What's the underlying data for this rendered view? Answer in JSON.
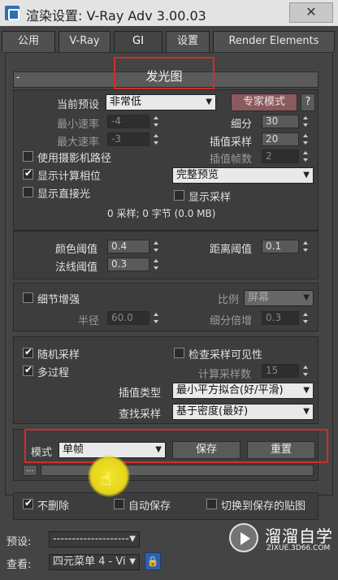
{
  "window": {
    "title": "渲染设置: V-Ray Adv 3.00.03",
    "close_glyph": "✕"
  },
  "tabs": [
    {
      "label": "公用"
    },
    {
      "label": "V-Ray"
    },
    {
      "label": "GI"
    },
    {
      "label": "设置"
    },
    {
      "label": "Render Elements"
    }
  ],
  "irradiance": {
    "title": "发光图",
    "collapse_glyph": "-",
    "preset_label": "当前预设",
    "preset_value": "非常低",
    "expert_button": "专家模式",
    "help_button": "?",
    "min_rate_label": "最小速率",
    "min_rate_value": "-4",
    "max_rate_label": "最大速率",
    "max_rate_value": "-3",
    "subdivs_label": "细分",
    "subdivs_value": "30",
    "interp_samples_label": "插值采样",
    "interp_samples_value": "20",
    "interp_frames_label": "插值帧数",
    "interp_frames_value": "2",
    "use_camera_path": "使用摄影机路径",
    "show_calc_phase": "显示计算相位",
    "show_direct_light": "显示直接光",
    "preview_mode": "完整预览",
    "show_samples": "显示采样",
    "stats": "0 采样; 0 字节 (0.0 MB)",
    "color_threshold_label": "颜色阈值",
    "color_threshold_value": "0.4",
    "normal_threshold_label": "法线阈值",
    "normal_threshold_value": "0.3",
    "distance_threshold_label": "距离阈值",
    "distance_threshold_value": "0.1",
    "detail_enhance": "细节增强",
    "scale_label": "比例",
    "scale_value": "屏幕",
    "radius_label": "半径",
    "radius_value": "60.0",
    "subdivs_mult_label": "细分倍增",
    "subdivs_mult_value": "0.3",
    "randomize_samples": "随机采样",
    "check_sample_visibility": "检查采样可见性",
    "multipass": "多过程",
    "calc_pass_samples_label": "计算采样数",
    "calc_pass_samples_value": "15",
    "interp_type_label": "插值类型",
    "interp_type_value": "最小平方拟合(好/平滑)",
    "lookup_label": "查找采样",
    "lookup_value": "基于密度(最好)",
    "mode_label": "模式",
    "mode_value": "单帧",
    "save_button": "保存",
    "reset_button": "重置",
    "browse_button": "...",
    "dont_delete": "不删除",
    "auto_save": "自动保存",
    "switch_to_saved": "切换到保存的贴图"
  },
  "footer": {
    "preset_label": "预设:",
    "preset_value": "--------------------",
    "view_label": "查看:",
    "view_value": "四元菜单 4 - Vi",
    "lock_glyph": "🔒"
  },
  "watermark": {
    "title": "溜溜自学",
    "url": "ZIXUE.3D66.COM"
  }
}
